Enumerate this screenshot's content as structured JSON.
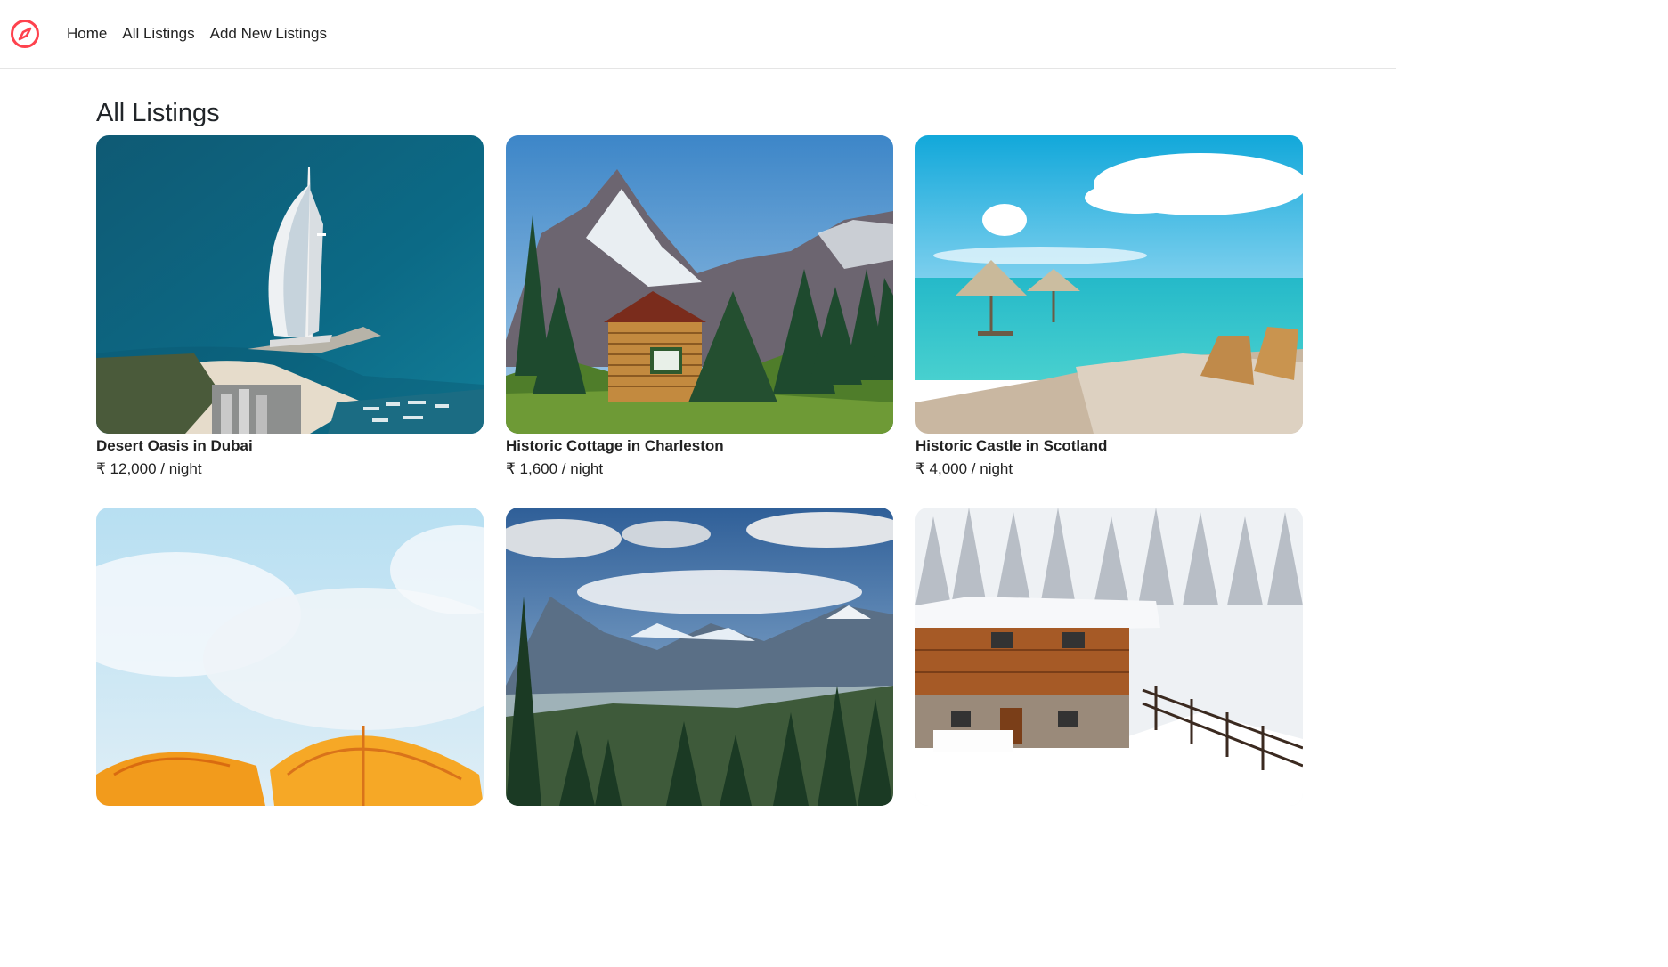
{
  "nav": {
    "brand_icon": "compass-icon",
    "brand_color": "#fe424d",
    "links": [
      "Home",
      "All Listings",
      "Add New Listings"
    ]
  },
  "page": {
    "title": "All Listings"
  },
  "listings": [
    {
      "title": "Desert Oasis in Dubai",
      "price": "₹ 12,000 / night",
      "image": "burj-al-arab-sea"
    },
    {
      "title": "Historic Cottage in Charleston",
      "price": "₹ 1,600 / night",
      "image": "log-cabin-mountains"
    },
    {
      "title": "Historic Castle in Scotland",
      "price": "₹ 4,000 / night",
      "image": "tropical-beach-umbrellas"
    },
    {
      "title": "",
      "price": "",
      "image": "orange-beach-umbrellas-sky"
    },
    {
      "title": "",
      "price": "",
      "image": "mountain-valley-forest"
    },
    {
      "title": "",
      "price": "",
      "image": "snowy-chalet"
    }
  ]
}
